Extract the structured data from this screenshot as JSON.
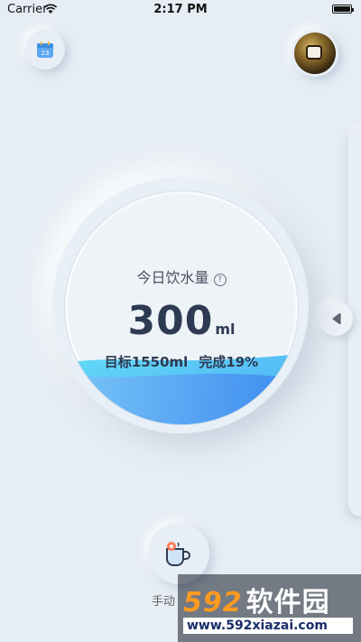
{
  "status_bar": {
    "carrier": "Carrier",
    "time": "2:17 PM"
  },
  "calendar": {
    "day": "23",
    "icon": "calendar-icon"
  },
  "gauge": {
    "title": "今日饮水量",
    "amount": "300",
    "unit": "ml",
    "target": "目标1550ml",
    "completion": "完成19%",
    "fill_fraction": 0.19
  },
  "actions": {
    "manual_label": "手动"
  },
  "watermark": {
    "brand_digits": "592",
    "brand_cn": "软件园",
    "url": "www.592xiazai.com"
  },
  "colors": {
    "background": "#e6edf4",
    "water_light": "#5fd7f5",
    "water_dark": "#4a9cf2",
    "text_primary": "#2d3a52"
  }
}
